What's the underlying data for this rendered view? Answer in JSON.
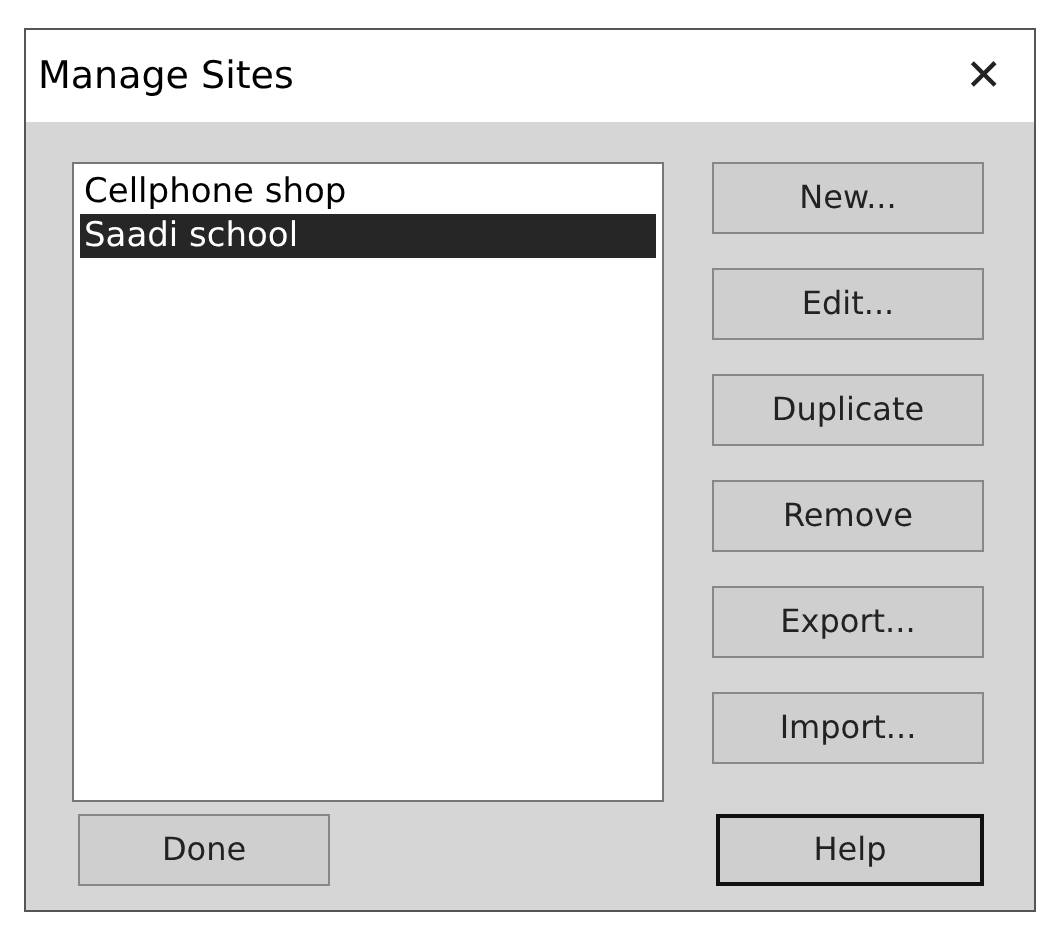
{
  "window": {
    "title": "Manage Sites",
    "close": "✕"
  },
  "sites": [
    {
      "name": "Cellphone shop",
      "selected": false
    },
    {
      "name": "Saadi school",
      "selected": true
    }
  ],
  "side_buttons": [
    "New...",
    "Edit...",
    "Duplicate",
    "Remove",
    "Export...",
    "Import..."
  ],
  "footer_buttons": [
    {
      "label": "Done",
      "default": false
    },
    {
      "label": "Help",
      "default": true
    }
  ]
}
